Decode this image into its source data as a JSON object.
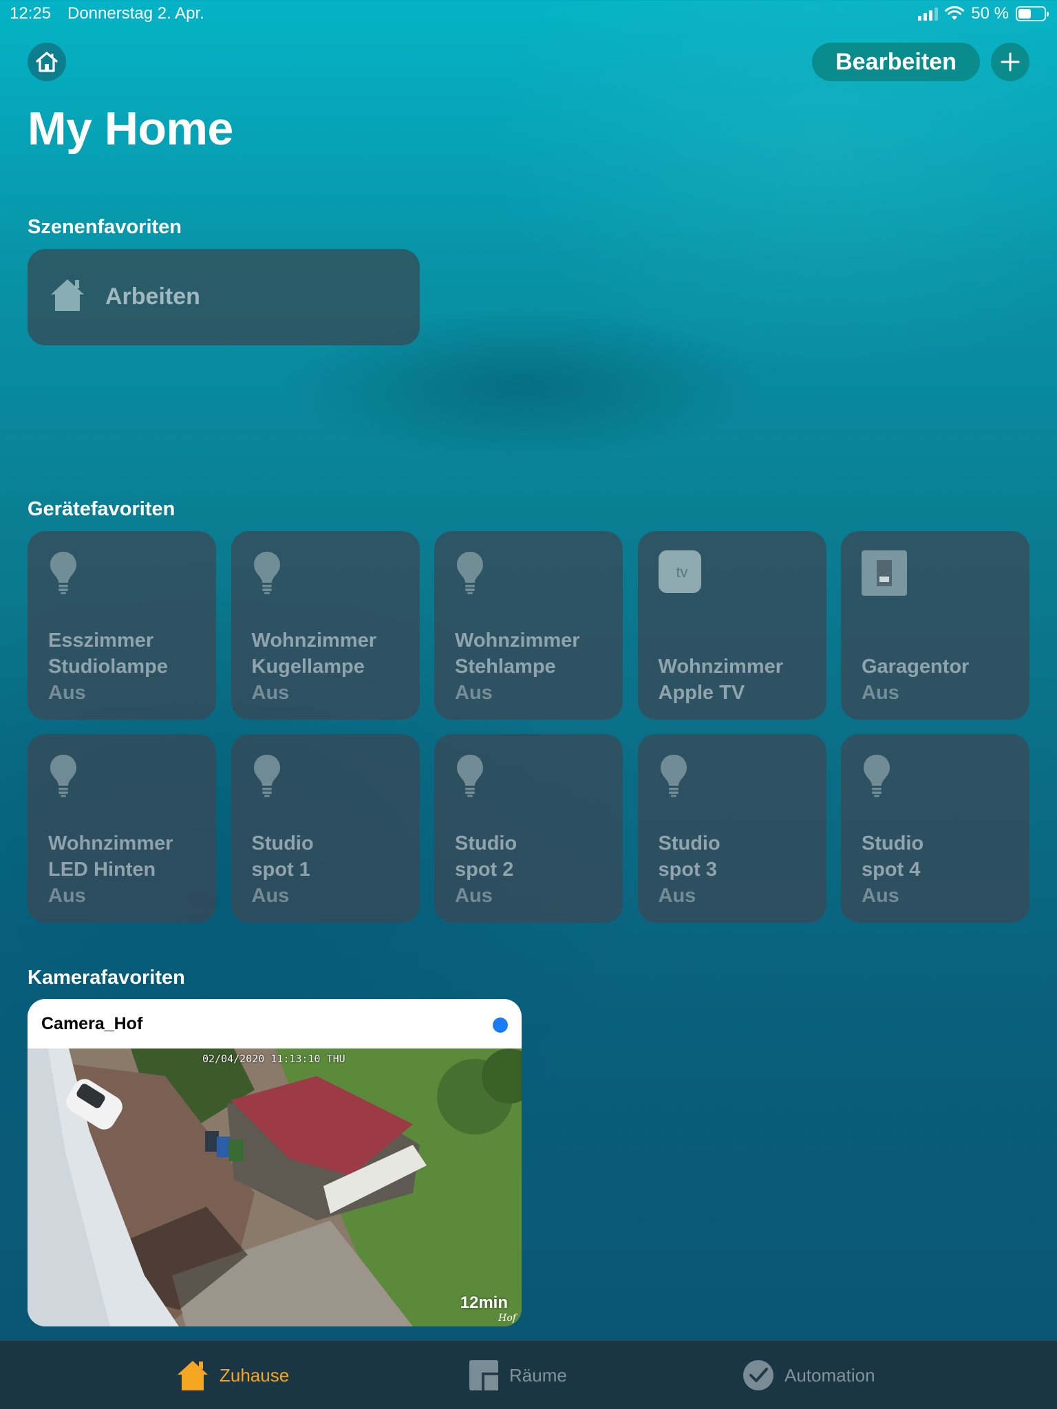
{
  "status_bar": {
    "time": "12:25",
    "date": "Donnerstag 2. Apr.",
    "battery_percent_label": "50 %",
    "battery_level": 0.5
  },
  "header": {
    "home_icon": "house-outline-icon",
    "edit_label": "Bearbeiten",
    "add_icon": "plus-icon",
    "title": "My Home"
  },
  "scenes": {
    "title": "Szenenfavoriten",
    "items": [
      {
        "label": "Arbeiten",
        "icon": "house-filled-icon"
      }
    ]
  },
  "devices": {
    "title": "Gerätefavoriten",
    "items": [
      {
        "line1": "Esszimmer",
        "line2": "Studiolampe",
        "status": "Aus",
        "icon": "lightbulb-icon"
      },
      {
        "line1": "Wohnzimmer",
        "line2": "Kugellampe",
        "status": "Aus",
        "icon": "lightbulb-icon"
      },
      {
        "line1": "Wohnzimmer",
        "line2": "Stehlampe",
        "status": "Aus",
        "icon": "lightbulb-icon"
      },
      {
        "line1": "Wohnzimmer",
        "line2": "Apple TV",
        "status": "",
        "icon": "apple-tv-icon",
        "icon_text": "tv"
      },
      {
        "line1": "",
        "line2": "Garagentor",
        "status": "Aus",
        "icon": "garage-door-icon"
      },
      {
        "line1": "Wohnzimmer",
        "line2": "LED Hinten",
        "status": "Aus",
        "icon": "lightbulb-icon"
      },
      {
        "line1": "Studio",
        "line2": "spot 1",
        "status": "Aus",
        "icon": "lightbulb-icon"
      },
      {
        "line1": "Studio",
        "line2": "spot 2",
        "status": "Aus",
        "icon": "lightbulb-icon"
      },
      {
        "line1": "Studio",
        "line2": "spot 3",
        "status": "Aus",
        "icon": "lightbulb-icon"
      },
      {
        "line1": "Studio",
        "line2": "spot 4",
        "status": "Aus",
        "icon": "lightbulb-icon"
      }
    ]
  },
  "cameras": {
    "title": "Kamerafavoriten",
    "items": [
      {
        "name": "Camera_Hof",
        "timestamp": "02/04/2020 11:13:10 THU",
        "age": "12min",
        "overlay_label": "Hof",
        "indicator_color": "#1a7cf5"
      }
    ]
  },
  "tabbar": {
    "tabs": [
      {
        "label": "Zuhause",
        "icon": "house-filled-icon",
        "active": true
      },
      {
        "label": "Räume",
        "icon": "rooms-icon",
        "active": false
      },
      {
        "label": "Automation",
        "icon": "checkmark-clock-icon",
        "active": false
      }
    ],
    "active_color": "#f5a623"
  }
}
